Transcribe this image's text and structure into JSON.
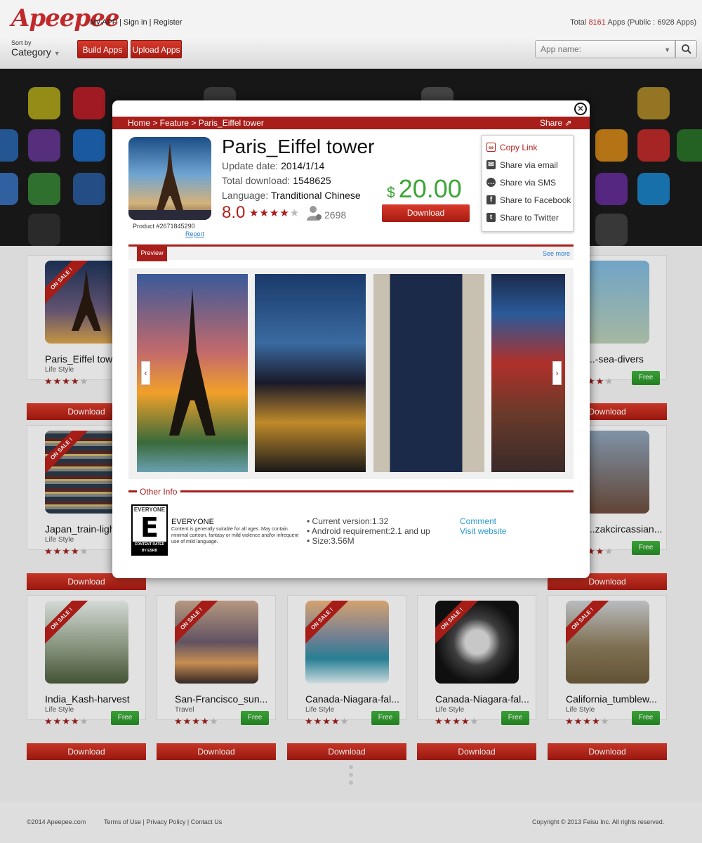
{
  "header": {
    "logo": "Apeepee",
    "links": [
      "My APP",
      "|",
      "Sign in",
      "|",
      "Register"
    ],
    "totals": {
      "prefix": "Total",
      "count": "8161",
      "mid": "Apps (Public :",
      "public": "6928",
      "suffix": "Apps)"
    }
  },
  "toolbar": {
    "sort_by": "Sort by",
    "sort_value": "Category",
    "build_btn": "Build Apps",
    "upload_btn": "Upload Apps",
    "search_placeholder": "App name:"
  },
  "cards": [
    {
      "title": "Paris_Eiffel tower",
      "category": "Life Style",
      "rating": 4,
      "price": "",
      "download": "Download",
      "ribbon": "ON SALE !",
      "thumb": "eiffel"
    },
    {
      "title": "...-sea-divers",
      "category": "",
      "rating": 3,
      "price": "Free",
      "download": "Download",
      "ribbon": "",
      "thumb": "divers"
    },
    {
      "title": "Japan_train-light",
      "category": "Life Style",
      "rating": 4,
      "price": "",
      "download": "Download",
      "ribbon": "ON SALE !",
      "thumb": "train"
    },
    {
      "title": "...zakcircassian...",
      "category": "",
      "rating": 3,
      "price": "Free",
      "download": "Download",
      "ribbon": "",
      "thumb": "girl"
    },
    {
      "title": "India_Kash-harvest",
      "category": "Life Style",
      "rating": 4,
      "price": "Free",
      "download": "Download",
      "ribbon": "ON SALE !",
      "thumb": "harvest"
    },
    {
      "title": "San-Francisco_sun...",
      "category": "Travel",
      "rating": 4,
      "price": "Free",
      "download": "Download",
      "ribbon": "ON SALE !",
      "thumb": "sanfran"
    },
    {
      "title": "Canada-Niagara-fal...",
      "category": "Life Style",
      "rating": 4,
      "price": "Free",
      "download": "Download",
      "ribbon": "ON SALE !",
      "thumb": "niagara"
    },
    {
      "title": "Canada-Niagara-fal...",
      "category": "Life Style",
      "rating": 4,
      "price": "Free",
      "download": "Download",
      "ribbon": "ON SALE !",
      "thumb": "fish"
    },
    {
      "title": "California_tumblew...",
      "category": "Life Style",
      "rating": 4,
      "price": "Free",
      "download": "Download",
      "ribbon": "ON SALE !",
      "thumb": "wagon"
    }
  ],
  "modal": {
    "breadcrumb": "Home > Feature >  Paris_Eiffel tower",
    "share_label": "Share",
    "title": "Paris_Eiffel tower",
    "update_label": "Update date:",
    "update_value": "2014/1/14",
    "downloads_label": "Total download:",
    "downloads_value": "1548625",
    "language_label": "Language:",
    "language_value": "Tranditional Chinese",
    "rating": "8.0",
    "stars": 4,
    "user_count": "2698",
    "product": "Product  #2671845290",
    "report": "Report",
    "price_currency": "$",
    "price": "20.00",
    "download": "Download",
    "share_menu": [
      {
        "label": "Copy Link",
        "icon": "link-icon",
        "active": true
      },
      {
        "label": "Share via email",
        "icon": "email-icon",
        "active": false
      },
      {
        "label": "Share via SMS",
        "icon": "sms-icon",
        "active": false
      },
      {
        "label": "Share to Facebook",
        "icon": "facebook-icon",
        "active": false
      },
      {
        "label": "Share to Twitter",
        "icon": "twitter-icon",
        "active": false
      }
    ],
    "preview_tab": "Preview",
    "see_more": "See more",
    "other_info": "Other Info",
    "esrb": {
      "top": "EVERYONE",
      "letter": "E",
      "bottom": "CONTENT RATED BY ESRB"
    },
    "everyone_title": "EVERYONE",
    "everyone_desc": "Content is generally suitable for all ages. May contain minimal cartoon, fantasy or mild violence and/or infrequent use of mild language.",
    "info": [
      "Current version:1.32",
      "Android requirement:2.1 and up",
      "Size:3.56M"
    ],
    "links": [
      "Comment",
      "Visit website"
    ]
  },
  "footer": {
    "copyright": "©2014 Apeepee.com",
    "links": "Terms of Use | Privacy Policy | Contact Us",
    "right": "Copyright © 2013 Feisu Inc. All rights reserved."
  },
  "colors": {
    "brand_red": "#a81e1a",
    "price_green": "#3ca536",
    "link_blue": "#2b9bd0"
  }
}
